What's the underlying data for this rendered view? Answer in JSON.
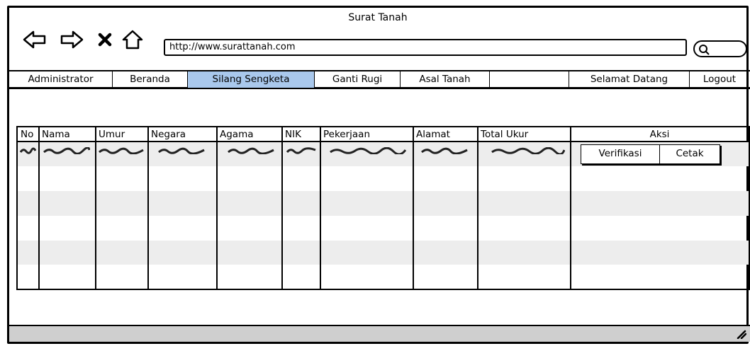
{
  "window": {
    "title": "Surat Tanah"
  },
  "browser": {
    "url": "http://www.surattanah.com",
    "icons": [
      "back-arrow-icon",
      "forward-arrow-icon",
      "close-icon",
      "home-icon",
      "search-icon"
    ]
  },
  "menu": {
    "items": [
      "Administrator",
      "Beranda",
      "Silang Sengketa",
      "Ganti Rugi",
      "Asal Tanah",
      "",
      "Selamat Datang",
      "Logout"
    ],
    "active": "Silang Sengketa"
  },
  "table": {
    "headers": [
      "No",
      "Nama",
      "Umur",
      "Negara",
      "Agama",
      "NIK",
      "Pekerjaan",
      "Alamat",
      "Total Ukur",
      "Aksi"
    ]
  },
  "actions": {
    "verify": "Verifikasi",
    "print": "Cetak"
  },
  "colors": {
    "active_tab": "#a9c8ec",
    "row_stripe": "#ededed",
    "statusbar": "#cfcfcf"
  }
}
